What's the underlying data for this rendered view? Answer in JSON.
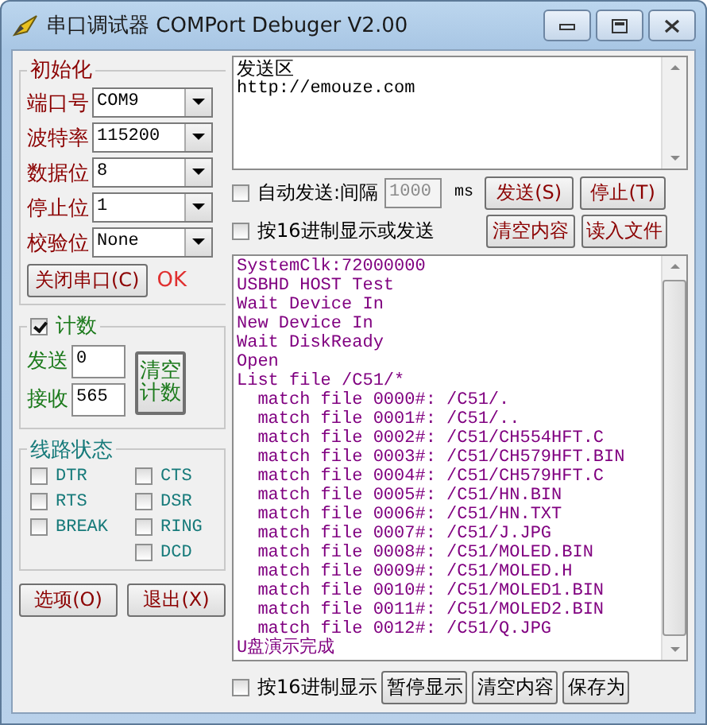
{
  "window": {
    "title": "串口调试器 COMPort Debuger V2.00"
  },
  "init": {
    "title": "初始化",
    "fields": [
      {
        "label": "端口号",
        "value": "COM9"
      },
      {
        "label": "波特率",
        "value": "115200"
      },
      {
        "label": "数据位",
        "value": "8"
      },
      {
        "label": "停止位",
        "value": "1"
      },
      {
        "label": "校验位",
        "value": "None"
      }
    ],
    "port_button": "关闭串口(C)",
    "status": "OK"
  },
  "counter": {
    "title": "计数",
    "checked": true,
    "sent_label": "发送",
    "sent": "0",
    "received_label": "接收",
    "received": "565",
    "clear_button": "清空计数"
  },
  "line_status": {
    "title": "线路状态",
    "left": [
      {
        "label": "DTR",
        "checked": false
      },
      {
        "label": "RTS",
        "checked": false
      },
      {
        "label": "BREAK",
        "checked": false
      }
    ],
    "right": [
      {
        "label": "CTS",
        "checked": false
      },
      {
        "label": "DSR",
        "checked": false
      },
      {
        "label": "RING",
        "checked": false
      },
      {
        "label": "DCD",
        "checked": false
      }
    ]
  },
  "bottom_buttons": [
    "选项(O)",
    "退出(X)"
  ],
  "send_area": {
    "title": "发送区",
    "value": "http://emouze.com"
  },
  "send_options": {
    "auto_send": {
      "label": "自动发送:间隔",
      "checked": false,
      "interval": "1000",
      "interval_disabled": true,
      "unit": "ms"
    },
    "hex_send": {
      "label": "按16进制显示或发送",
      "checked": false
    },
    "buttons": [
      "发送(S)",
      "停止(T)",
      "清空内容",
      "读入文件"
    ]
  },
  "receive_area": {
    "lines": [
      "SystemClk:72000000",
      "USBHD HOST Test",
      "Wait Device In",
      "New Device In",
      "Wait DiskReady",
      "Open",
      "List file /C51/*",
      "  match file 0000#: /C51/.",
      "  match file 0001#: /C51/..",
      "  match file 0002#: /C51/CH554HFT.C",
      "  match file 0003#: /C51/CH579HFT.BIN",
      "  match file 0004#: /C51/CH579HFT.C",
      "  match file 0005#: /C51/HN.BIN",
      "  match file 0006#: /C51/HN.TXT",
      "  match file 0007#: /C51/J.JPG",
      "  match file 0008#: /C51/MOLED.BIN",
      "  match file 0009#: /C51/MOLED.H",
      "  match file 0010#: /C51/MOLED1.BIN",
      "  match file 0011#: /C51/MOLED2.BIN",
      "  match file 0012#: /C51/Q.JPG",
      "U盘演示完成"
    ]
  },
  "receive_options": {
    "hex_display": {
      "label": "按16进制显示",
      "checked": false
    },
    "buttons": [
      "暂停显示",
      "清空内容",
      "保存为"
    ]
  }
}
